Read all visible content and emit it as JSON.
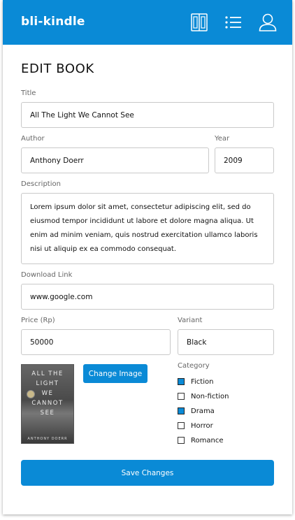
{
  "app": {
    "brand": "bli-kindle"
  },
  "header": {
    "icons": [
      "book-icon",
      "list-icon",
      "user-icon"
    ]
  },
  "page": {
    "title": "EDIT BOOK"
  },
  "form": {
    "title_label": "Title",
    "title_value": "All The Light We Cannot See",
    "author_label": "Author",
    "author_value": "Anthony Doerr",
    "year_label": "Year",
    "year_value": "2009",
    "description_label": "Description",
    "description_value": "Lorem ipsum dolor sit amet, consectetur adipiscing elit, sed do eiusmod tempor incididunt ut labore et dolore magna aliqua. Ut enim ad minim veniam, quis nostrud exercitation ullamco laboris nisi ut aliquip ex ea commodo consequat.",
    "download_label": "Download Link",
    "download_value": "www.google.com",
    "price_label": "Price (Rp)",
    "price_value": "50000",
    "variant_label": "Variant",
    "variant_value": "Black",
    "change_image_label": "Change Image",
    "category_label": "Category",
    "categories": [
      {
        "label": "Fiction",
        "checked": true
      },
      {
        "label": "Non-fiction",
        "checked": false
      },
      {
        "label": "Drama",
        "checked": true
      },
      {
        "label": "Horror",
        "checked": false
      },
      {
        "label": "Romance",
        "checked": false
      }
    ],
    "save_label": "Save Changes"
  },
  "cover": {
    "title_lines": [
      "ALL THE",
      "LIGHT",
      "WE",
      "CANNOT",
      "SEE"
    ],
    "author": "ANTHONY DOERR"
  },
  "colors": {
    "accent": "#0a8ad6",
    "border": "#c9c9c9",
    "label": "#666666"
  }
}
